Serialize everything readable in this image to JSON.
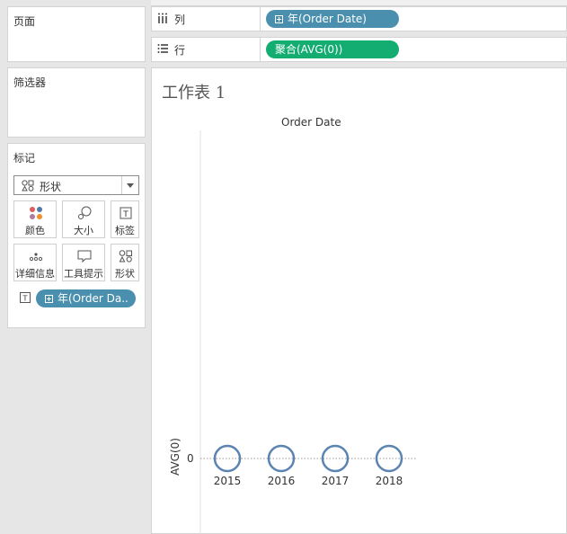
{
  "left_panel": {
    "pages_title": "页面",
    "filters_title": "筛选器",
    "marks": {
      "title": "标记",
      "mark_type": "形状",
      "buttons": [
        {
          "label": "颜色",
          "icon": "color-dots-icon"
        },
        {
          "label": "大小",
          "icon": "size-icon"
        },
        {
          "label": "标签",
          "icon": "label-T-icon"
        },
        {
          "label": "详细信息",
          "icon": "detail-dots-icon"
        },
        {
          "label": "工具提示",
          "icon": "tooltip-icon"
        },
        {
          "label": "形状",
          "icon": "shape-icon"
        }
      ],
      "field_pill": "年(Order Da.."
    }
  },
  "shelves": {
    "columns": {
      "label": "列",
      "pill": "年(Order Date)",
      "pill_color": "#4a8fae"
    },
    "rows": {
      "label": "行",
      "pill": "聚合(AVG(0))",
      "pill_color": "#13ad72"
    }
  },
  "worksheet": {
    "title": "工作表 1",
    "header": "Order Date",
    "y_label": "AVG(0)",
    "y_tick": "0"
  },
  "chart_data": {
    "type": "scatter",
    "title": "",
    "header": "Order Date",
    "ylabel": "AVG(0)",
    "categories": [
      "2015",
      "2016",
      "2017",
      "2018"
    ],
    "values": [
      0,
      0,
      0,
      0
    ],
    "yticks": [
      "0"
    ],
    "marker": "open circle",
    "marker_color": "#5b84b1"
  }
}
